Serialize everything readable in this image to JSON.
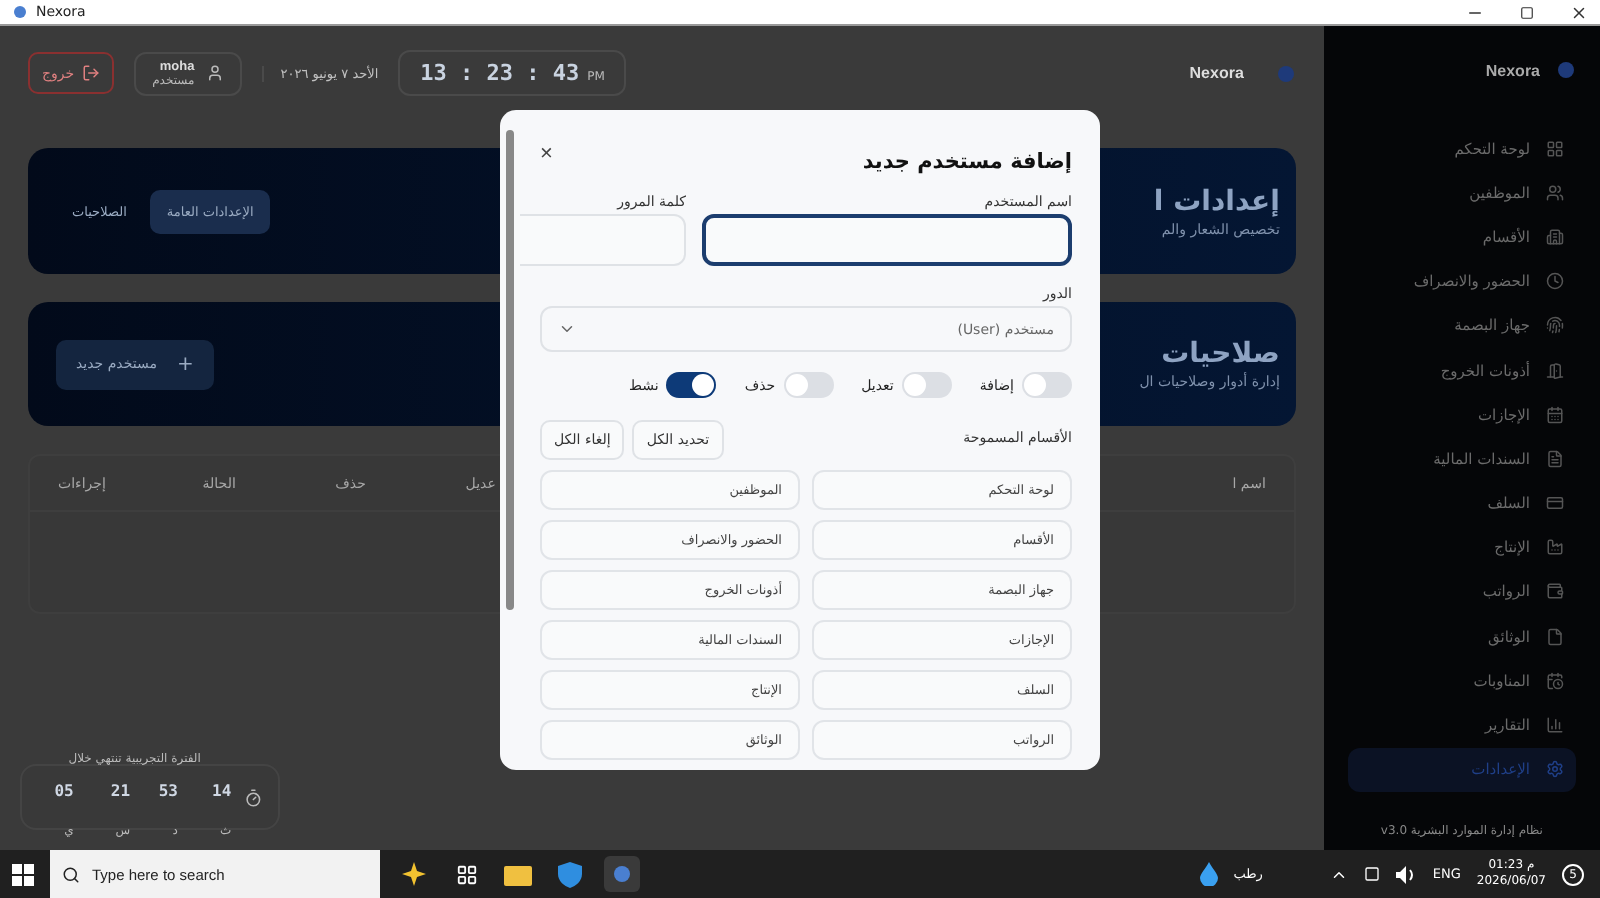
{
  "window": {
    "title": "Nexora"
  },
  "sidebar": {
    "brand": "Nexora",
    "items": [
      {
        "label": "لوحة التحكم",
        "selected": false
      },
      {
        "label": "الموظفين",
        "selected": false
      },
      {
        "label": "الأقسام",
        "selected": false
      },
      {
        "label": "الحضور والانصراف",
        "selected": false
      },
      {
        "label": "جهاز البصمة",
        "selected": false
      },
      {
        "label": "أذونات الخروج",
        "selected": false
      },
      {
        "label": "الإجازات",
        "selected": false
      },
      {
        "label": "السندات المالية",
        "selected": false
      },
      {
        "label": "السلف",
        "selected": false
      },
      {
        "label": "الإنتاج",
        "selected": false
      },
      {
        "label": "الرواتب",
        "selected": false
      },
      {
        "label": "الوثائق",
        "selected": false
      },
      {
        "label": "المناوبات",
        "selected": false
      },
      {
        "label": "التقارير",
        "selected": false
      },
      {
        "label": "الإعدادات",
        "selected": true
      }
    ],
    "footer": "نظام إدارة الموارد البشرية v3.0"
  },
  "header": {
    "brand": "Nexora",
    "clock": {
      "time": "13 : 23 : 43",
      "period": "PM"
    },
    "date": "الأحد ٧ يونيو ٢٠٢٦",
    "user": {
      "name": "moha",
      "role": "مستخدم"
    },
    "logout": "خروج"
  },
  "settings_card": {
    "title": "إعدادات ا",
    "subtitle": "تخصيص الشعار والم",
    "tabs": [
      {
        "label": "الإعدادات العامة",
        "selected": true
      },
      {
        "label": "الصلاحيات",
        "selected": false
      }
    ]
  },
  "permissions_card": {
    "title": "صلاحيات",
    "subtitle": "إدارة أدوار وصلاحيات ال",
    "new_user_button": "مستخدم جديد",
    "plus": "+"
  },
  "table": {
    "columns": [
      "اسم ا",
      "عديل",
      "حذف",
      "الحالة",
      "إجراءات"
    ]
  },
  "trial": {
    "label": "الفترة التجريبية تنتهي خلال",
    "parts": [
      {
        "value": "14",
        "unit": "ث"
      },
      {
        "value": "53",
        "unit": "د"
      },
      {
        "value": "21",
        "unit": "س"
      },
      {
        "value": "05",
        "unit": "ي"
      }
    ]
  },
  "modal": {
    "title": "إضافة مستخدم جديد",
    "close": "×",
    "fields": [
      {
        "label": "اسم المستخدم",
        "focused": true
      },
      {
        "label": "كلمة المرور",
        "focused": false
      }
    ],
    "role": {
      "label": "الدور",
      "value": "مستخدم (User)"
    },
    "permissions": [
      {
        "label": "إضافة",
        "on": false
      },
      {
        "label": "تعديل",
        "on": false
      },
      {
        "label": "حذف",
        "on": false
      },
      {
        "label": "نشط",
        "on": true
      }
    ],
    "sections_label": "الأقسام المسموحة",
    "select_all": "تحديد الكل",
    "clear_all": "إلغاء الكل",
    "sections": [
      {
        "label": "لوحة التحكم",
        "selected": false
      },
      {
        "label": "الموظفين",
        "selected": false
      },
      {
        "label": "الأقسام",
        "selected": false
      },
      {
        "label": "الحضور والانصراف",
        "selected": false
      },
      {
        "label": "جهاز البصمة",
        "selected": false
      },
      {
        "label": "أذونات الخروج",
        "selected": false
      },
      {
        "label": "الإجازات",
        "selected": false
      },
      {
        "label": "السندات المالية",
        "selected": false
      },
      {
        "label": "السلف",
        "selected": false
      },
      {
        "label": "الإنتاج",
        "selected": false
      },
      {
        "label": "الرواتب",
        "selected": false
      },
      {
        "label": "الوثائق",
        "selected": false
      }
    ]
  },
  "taskbar": {
    "search_placeholder": "Type here to search",
    "weather": "رطب",
    "language": "ENG",
    "time": "01:23 م",
    "date": "2026/06/07",
    "notifications": "5"
  }
}
